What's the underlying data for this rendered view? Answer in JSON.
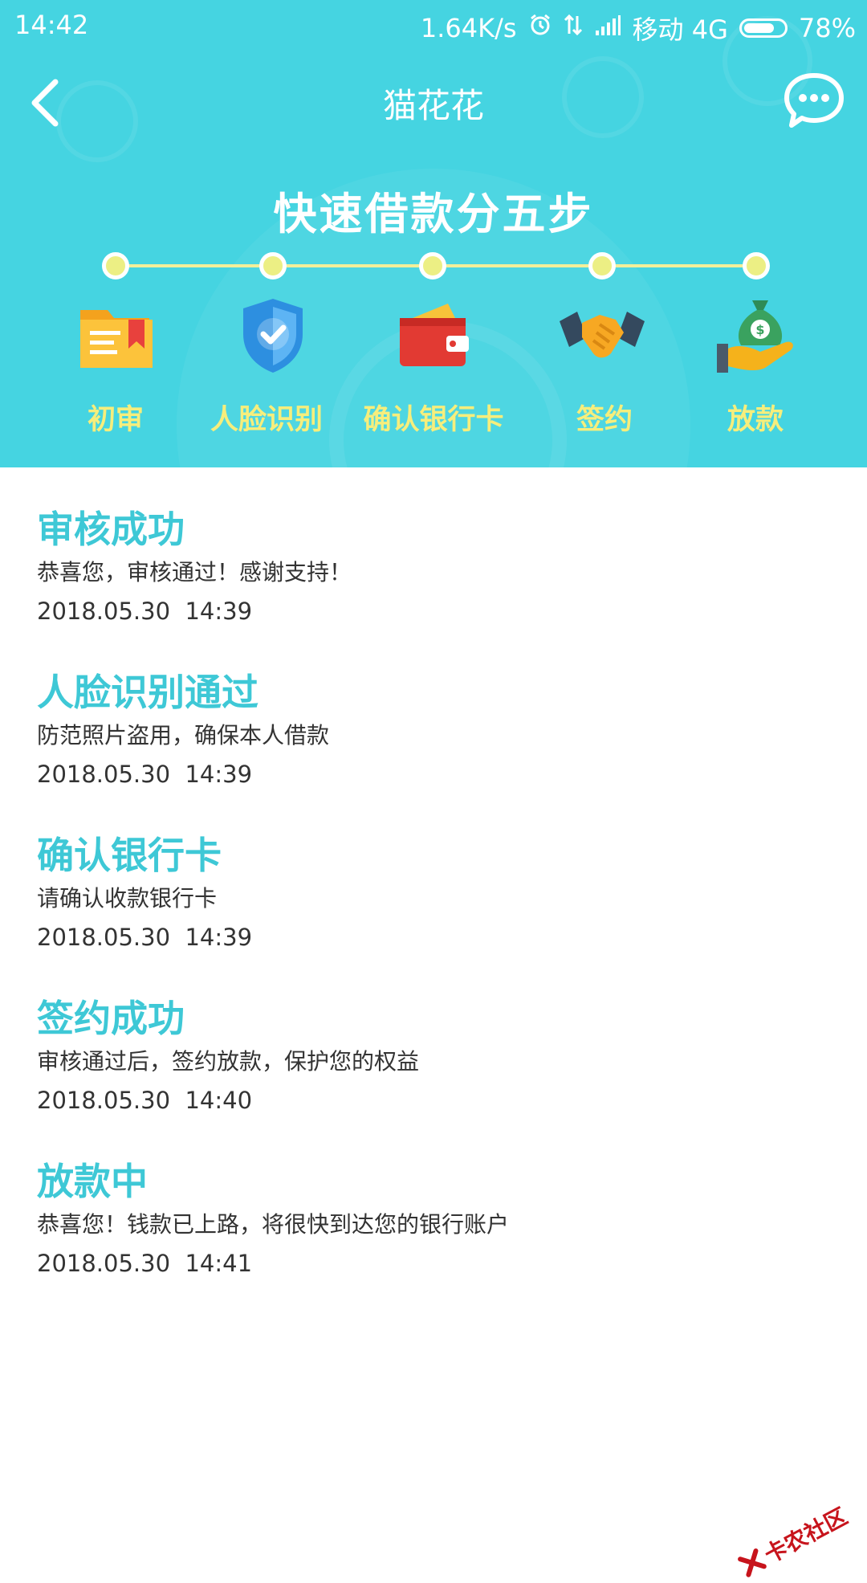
{
  "status_bar": {
    "time": "14:42",
    "speed": "1.64K/s",
    "carrier": "移动 4G",
    "battery": "78%",
    "battery_level": 0.78
  },
  "titlebar": {
    "title": "猫花花",
    "back_icon": "chevron-left-icon",
    "message_icon": "chat-bubble-icon"
  },
  "steps": {
    "heading": "快速借款分五步",
    "items": [
      {
        "label": "初审",
        "icon": "folder-icon"
      },
      {
        "label": "人脸识别",
        "icon": "shield-check-icon"
      },
      {
        "label": "确认银行卡",
        "icon": "wallet-icon"
      },
      {
        "label": "签约",
        "icon": "handshake-icon"
      },
      {
        "label": "放款",
        "icon": "money-bag-hand-icon"
      }
    ]
  },
  "timeline": [
    {
      "title": "审核成功",
      "desc": "恭喜您，审核通过！感谢支持！",
      "time": "2018.05.30  14:39"
    },
    {
      "title": "人脸识别通过",
      "desc": "防范照片盗用，确保本人借款",
      "time": "2018.05.30  14:39"
    },
    {
      "title": "确认银行卡",
      "desc": "请确认收款银行卡",
      "time": "2018.05.30  14:39"
    },
    {
      "title": "签约成功",
      "desc": "审核通过后，签约放款，保护您的权益",
      "time": "2018.05.30  14:40"
    },
    {
      "title": "放款中",
      "desc": "恭喜您！钱款已上路，将很快到达您的银行账户",
      "time": "2018.05.30  14:41"
    }
  ],
  "watermark": {
    "text": "卡农社区"
  },
  "colors": {
    "header_bg": "#45d4e1",
    "accent_title": "#3ec8d6",
    "step_label": "#f6ee7c",
    "progress_dot": "#ecef84"
  }
}
